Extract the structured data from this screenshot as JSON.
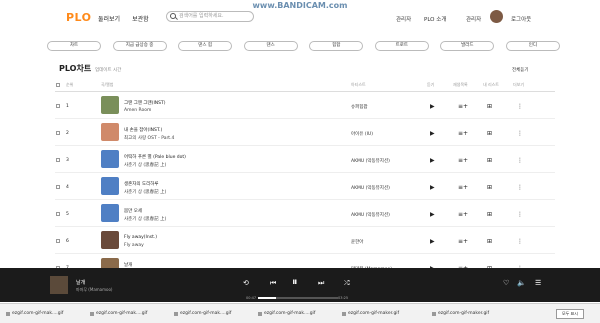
{
  "watermark": "www.BANDICAM.com",
  "header": {
    "logo": "PLO",
    "nav": [
      "둘러보기",
      "보관함"
    ],
    "search_placeholder": "검색어를 입력하세요.",
    "right": [
      "관리자",
      "PLO 소개",
      "관리자",
      "로그아웃"
    ]
  },
  "genres": [
    "차트",
    "지금 급상승 중",
    "댄스 힙",
    "댄스",
    "힙합",
    "트로트",
    "발라드",
    "인디"
  ],
  "chart": {
    "title": "PLO차트",
    "subtitle": "업데이트 시간",
    "all_play": "전체듣기",
    "headers": [
      "순위",
      "곡/앨범",
      "아티스트",
      "듣기",
      "재생목록",
      "내 리스트",
      "더보기"
    ],
    "rows": [
      {
        "rank": "1",
        "song": "그땐 그땐 그땐(INST)",
        "album": "Amen Room",
        "artist": "슈퍼힙팝",
        "art_color": "#7a8f5a"
      },
      {
        "rank": "2",
        "song": "내 손을 잡아(INST.)",
        "album": "최고의 사랑 OST - Part.4",
        "artist": "아이유 (IU)",
        "art_color": "#d08a6a"
      },
      {
        "rank": "3",
        "song": "어떡하 푸른 별 (Pale blue dot)",
        "album": "사춘기 상 (思春記 上)",
        "artist": "AKMU (악동뮤지션)",
        "art_color": "#4f7fc4"
      },
      {
        "rank": "4",
        "song": "생존자의 도리하루",
        "album": "사춘기 상 (思春記 上)",
        "artist": "AKMU (악동뮤지션)",
        "art_color": "#4f7fc4"
      },
      {
        "rank": "5",
        "song": "몸만 오세",
        "album": "사춘기 상 (思春記 上)",
        "artist": "AKMU (악동뮤지션)",
        "art_color": "#4f7fc4"
      },
      {
        "rank": "6",
        "song": "Fly away(Inst.)",
        "album": "Fly away",
        "artist": "윤한아",
        "art_color": "#6a4a3a"
      },
      {
        "rank": "7",
        "song": "날개",
        "album": "마연정",
        "artist": "마마무 (Mamamoo)",
        "art_color": "#8a6a4a"
      }
    ]
  },
  "player": {
    "title": "날개",
    "artist": "마마무 (Mamamoo)",
    "time_current": "00:47",
    "time_total": "03:25",
    "progress": 0.23
  },
  "taskbar": {
    "items": [
      "ezgif.com-gif-mak....gif",
      "ezgif.com-gif-mak....gif",
      "ezgif.com-gif-mak....gif",
      "ezgif.com-gif-mak....gif",
      "ezgif.com-gif-maker.gif",
      "ezgif.com-gif-maker.gif"
    ],
    "button": "모두 표시"
  }
}
